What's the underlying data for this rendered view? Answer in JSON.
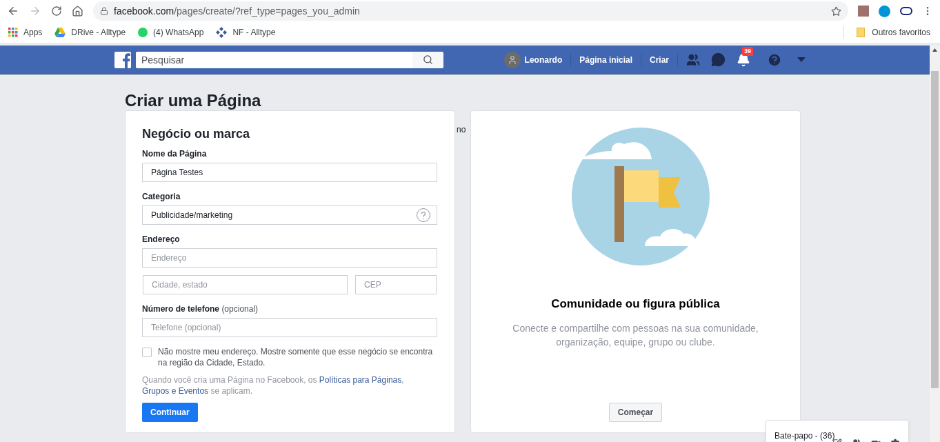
{
  "browser": {
    "url_host": "facebook.com",
    "url_path": "/pages/create/?ref_type=pages_you_admin",
    "bookmarks": [
      {
        "kind": "apps",
        "label": "Apps"
      },
      {
        "kind": "drive",
        "label": "DRive - Alltype"
      },
      {
        "kind": "whatsapp",
        "label": "(4) WhatsApp"
      },
      {
        "kind": "diamond",
        "label": "NF - Alltype"
      }
    ],
    "other_bookmarks": "Outros favoritos"
  },
  "navbar": {
    "search_placeholder": "Pesquisar",
    "user": "Leonardo",
    "links": [
      "Página inicial",
      "Criar"
    ],
    "notification_count": "39"
  },
  "page_title": "Criar uma Página",
  "behind_text": "no",
  "business_card": {
    "title": "Negócio ou marca",
    "page_name": {
      "label": "Nome da Página",
      "value": "Página Testes"
    },
    "category": {
      "label": "Categoria",
      "value": "Publicidade/marketing"
    },
    "address": {
      "label": "Endereço",
      "placeholder": "Endereço",
      "city_placeholder": "Cidade, estado",
      "zip_placeholder": "CEP"
    },
    "phone": {
      "label": "Número de telefone",
      "label_note": "(opcional)",
      "placeholder": "Telefone (opcional)"
    },
    "hide_address": {
      "checked": false,
      "label": "Não mostre meu endereço. Mostre somente que esse negócio se encontra na região da Cidade, Estado."
    },
    "policy": {
      "before": "Quando você cria uma Página no Facebook, os ",
      "link_1": "Políticas para Páginas",
      "between": ", ",
      "link_2": "Grupos e Eventos",
      "after": " se aplicam."
    },
    "button": "Continuar"
  },
  "community_card": {
    "title": "Comunidade ou figura pública",
    "description": "Conecte e compartilhe com pessoas na sua comunidade, organização, equipe, grupo ou clube.",
    "button": "Começar"
  },
  "chat": {
    "title": "Bate-papo - (36)"
  }
}
